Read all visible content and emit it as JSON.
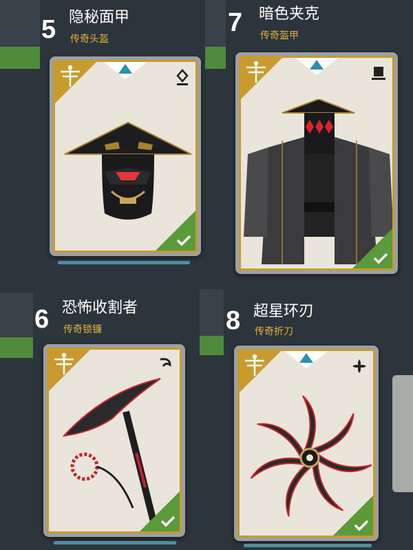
{
  "items": [
    {
      "number": "5",
      "name": "隐秘面甲",
      "rarity_type": "传奇头盔",
      "class_icon": "location-pin-icon",
      "has_rarity_gem": true,
      "equipped": true
    },
    {
      "number": "7",
      "name": "暗色夹克",
      "rarity_type": "传奇盔甲",
      "class_icon": "armor-square-icon",
      "has_rarity_gem": true,
      "equipped": true
    },
    {
      "number": "6",
      "name": "恐怖收割者",
      "rarity_type": "传奇锁镰",
      "class_icon": "kusarigama-icon",
      "has_rarity_gem": false,
      "equipped": true
    },
    {
      "number": "8",
      "name": "超星环刃",
      "rarity_type": "传奇折刀",
      "class_icon": "shuriken-icon",
      "has_rarity_gem": true,
      "equipped": true
    }
  ],
  "colors": {
    "gold": "#c99a2e",
    "title_gold": "#e3b13c",
    "check_green": "#5a9a3a",
    "gem_blue": "#2a8fb0"
  }
}
